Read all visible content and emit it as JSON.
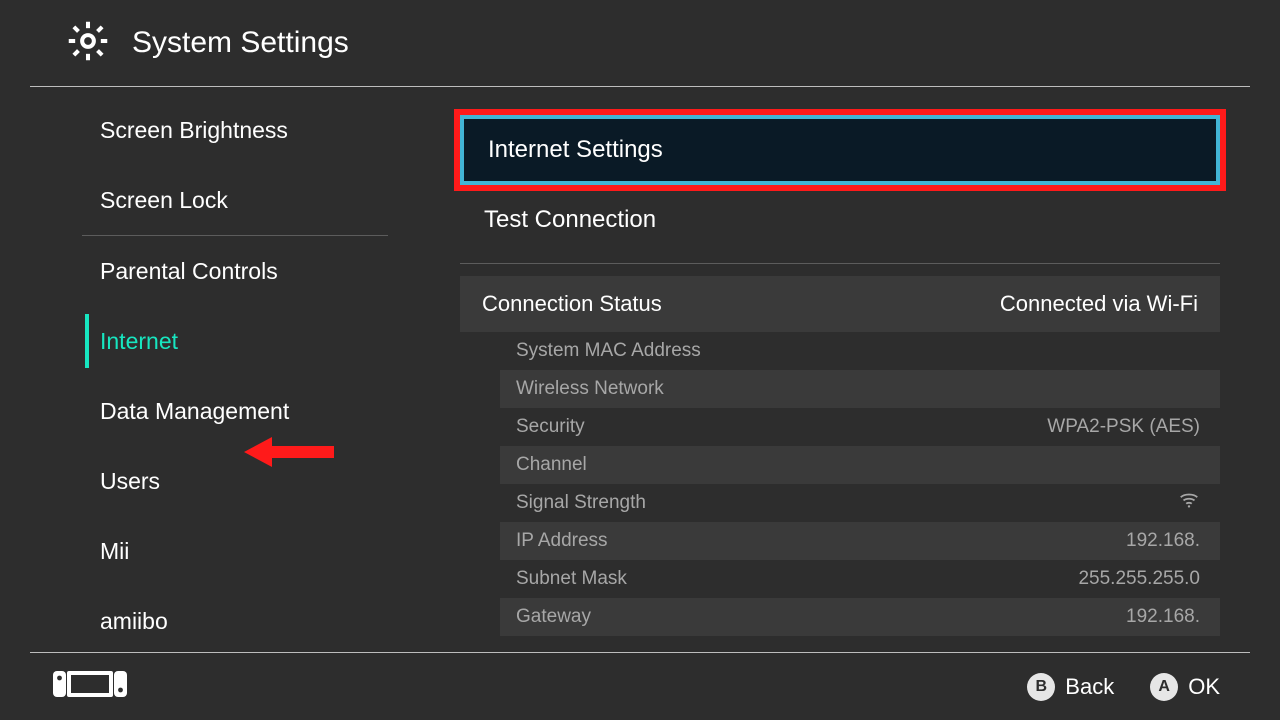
{
  "header": {
    "title": "System Settings"
  },
  "sidebar": {
    "items": [
      {
        "label": "Screen Brightness"
      },
      {
        "label": "Screen Lock"
      },
      {
        "label": "Parental Controls"
      },
      {
        "label": "Internet"
      },
      {
        "label": "Data Management"
      },
      {
        "label": "Users"
      },
      {
        "label": "Mii"
      },
      {
        "label": "amiibo"
      }
    ]
  },
  "main": {
    "menu": [
      {
        "label": "Internet Settings"
      },
      {
        "label": "Test Connection"
      }
    ],
    "status_header": {
      "label": "Connection Status",
      "value": "Connected via Wi-Fi"
    },
    "details": [
      {
        "label": "System MAC Address",
        "value": ""
      },
      {
        "label": "Wireless Network",
        "value": ""
      },
      {
        "label": "Security",
        "value": "WPA2-PSK (AES)"
      },
      {
        "label": "Channel",
        "value": ""
      },
      {
        "label": "Signal Strength",
        "value": ""
      },
      {
        "label": "IP Address",
        "value": "192.168."
      },
      {
        "label": "Subnet Mask",
        "value": "255.255.255.0"
      },
      {
        "label": "Gateway",
        "value": "192.168."
      }
    ]
  },
  "footer": {
    "back": {
      "key": "B",
      "label": "Back"
    },
    "ok": {
      "key": "A",
      "label": "OK"
    }
  },
  "annotations": {
    "highlight_target": "menu-item-internet-settings",
    "arrow_target": "sidebar-item-internet"
  },
  "colors": {
    "accent": "#17e6c0",
    "focus_ring": "#42b5d6",
    "callout": "#ff1a1a"
  }
}
